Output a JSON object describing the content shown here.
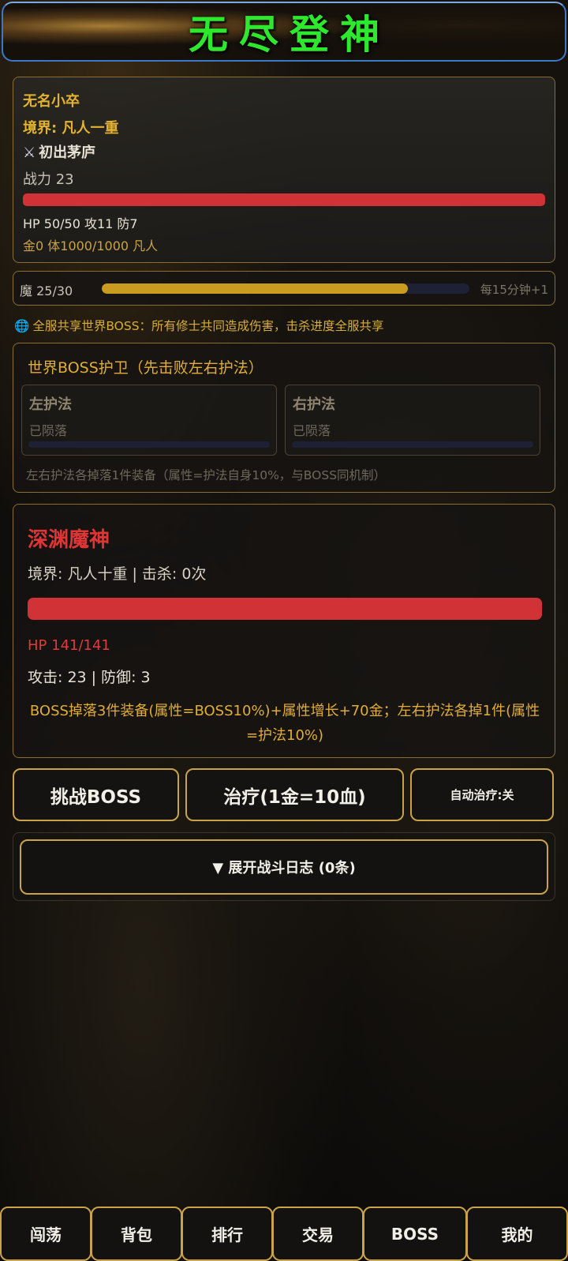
{
  "header": {
    "title": "无尽登神"
  },
  "player": {
    "name": "无名小卒",
    "realm": "境界: 凡人一重",
    "title_icon": "crossed-swords-icon",
    "title": "初出茅庐",
    "power": "战力 23",
    "hp_fraction": 1.0,
    "stats": "HP 50/50 攻11 防7",
    "extra": "金0 体1000/1000 凡人"
  },
  "mana": {
    "label": "魔 25/30",
    "fraction": 0.833,
    "regen": "每15分钟+1"
  },
  "notice": {
    "icon": "globe-icon",
    "text": "全服共享世界BOSS：所有修士共同造成伤害，击杀进度全服共享"
  },
  "guards": {
    "title": "世界BOSS护卫（先击败左右护法）",
    "left": {
      "name": "左护法",
      "status": "已陨落",
      "hp_fraction": 0
    },
    "right": {
      "name": "右护法",
      "status": "已陨落",
      "hp_fraction": 0
    },
    "note": "左右护法各掉落1件装备（属性=护法自身10%，与BOSS同机制）"
  },
  "boss": {
    "name": "深渊魔神",
    "realm": "境界: 凡人十重 | 击杀: 0次",
    "hp_fraction": 1.0,
    "hp": "HP 141/141",
    "atk_def": "攻击: 23 | 防御: 3",
    "drop": "BOSS掉落3件装备(属性=BOSS10%)+属性增长+70金；左右护法各掉1件(属性=护法10%)"
  },
  "actions": {
    "challenge": "挑战BOSS",
    "heal": "治疗(1金=10血)",
    "auto_heal": "自动治疗:关"
  },
  "log": {
    "toggle": "▼ 展开战斗日志 (0条)"
  },
  "nav": [
    "闯荡",
    "背包",
    "排行",
    "交易",
    "BOSS",
    "我的"
  ],
  "colors": {
    "accent_gold": "#c9a24a",
    "hp_red": "#d03236",
    "title_green": "#2ee82e"
  }
}
